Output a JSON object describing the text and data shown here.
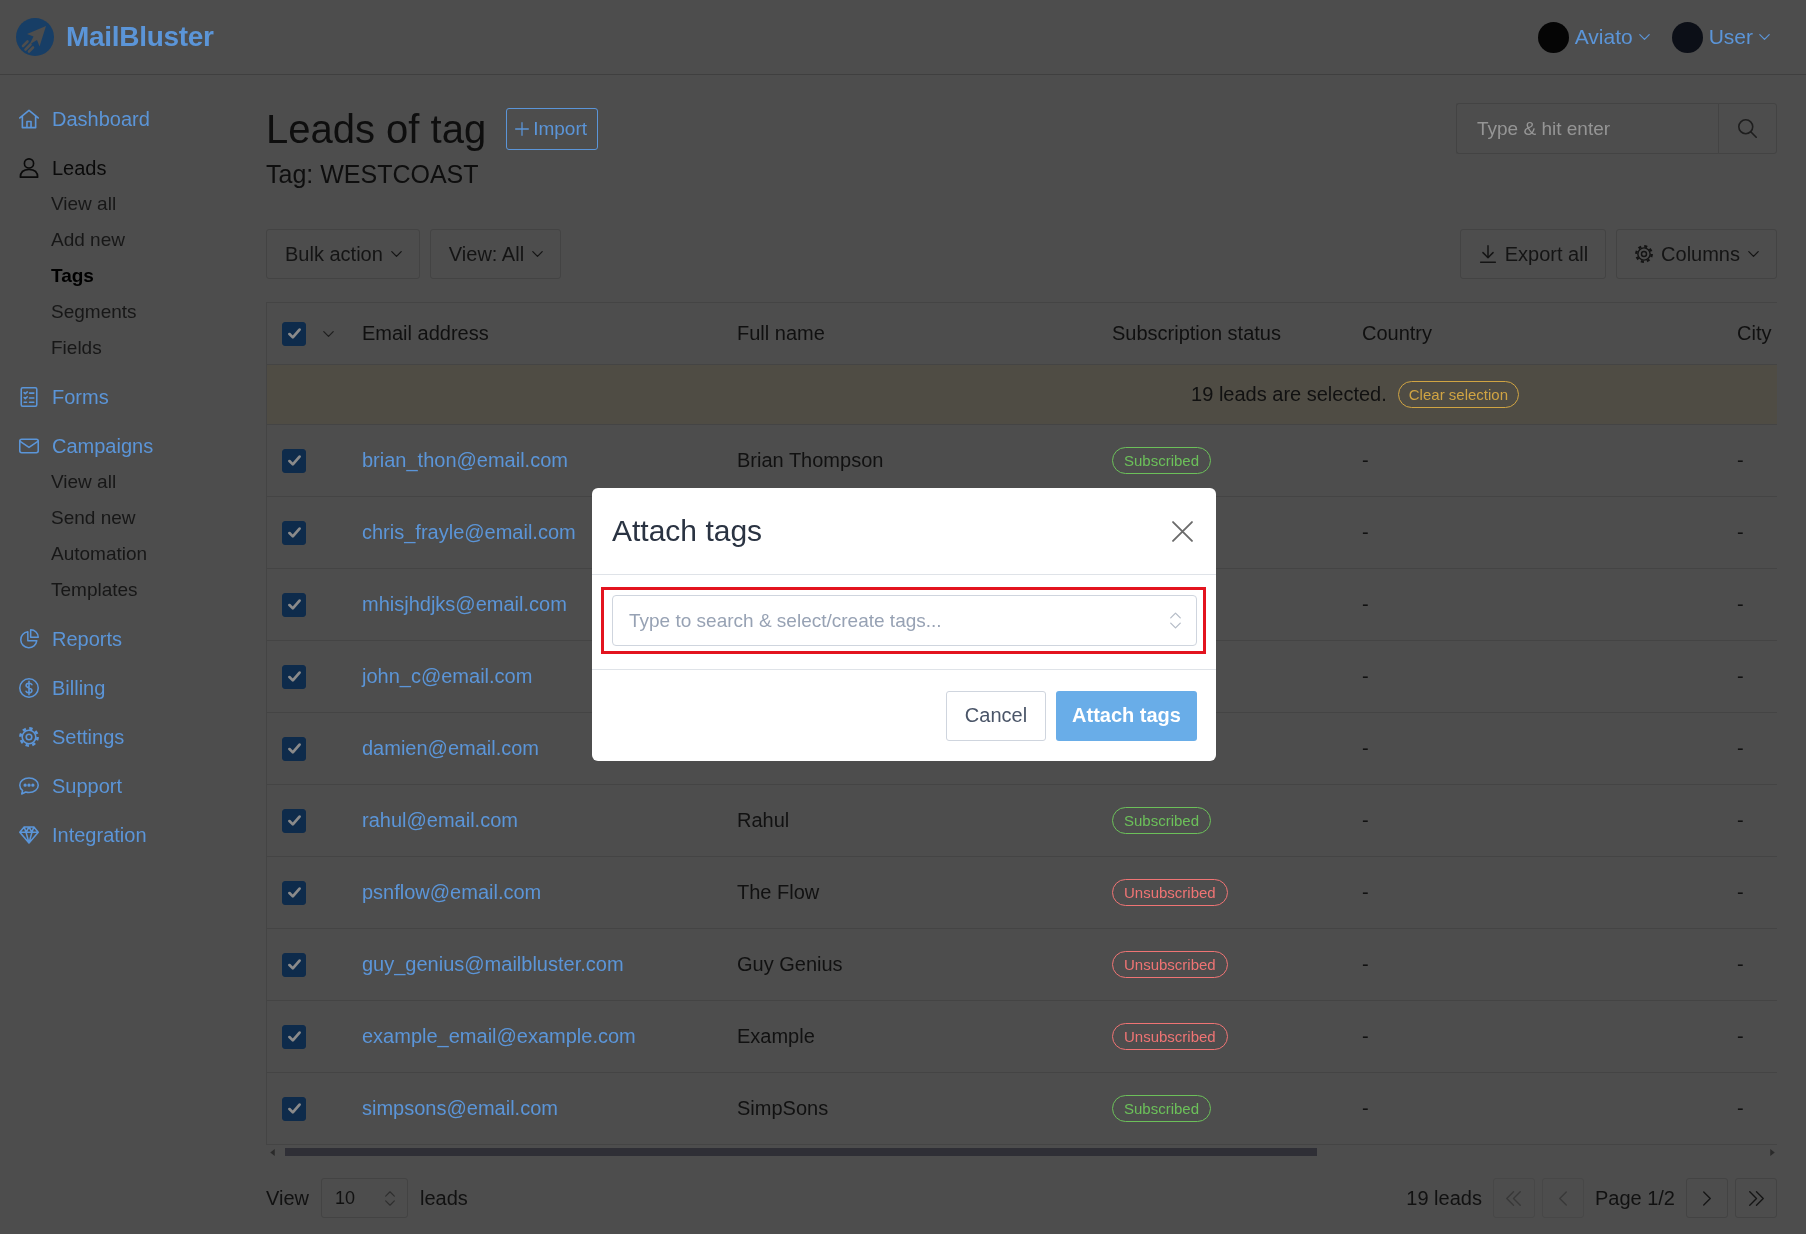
{
  "header": {
    "logo_text": "MailBluster",
    "menus": [
      {
        "label": "Aviato"
      },
      {
        "label": "User"
      }
    ]
  },
  "sidebar": {
    "items": [
      {
        "label": "Dashboard",
        "selected": false
      },
      {
        "label": "Leads",
        "selected": true,
        "children": [
          {
            "label": "View all",
            "selected": false
          },
          {
            "label": "Add new",
            "selected": false
          },
          {
            "label": "Tags",
            "selected": true
          },
          {
            "label": "Segments",
            "selected": false
          },
          {
            "label": "Fields",
            "selected": false
          }
        ]
      },
      {
        "label": "Forms",
        "selected": false
      },
      {
        "label": "Campaigns",
        "selected": false,
        "children": [
          {
            "label": "View all",
            "selected": false
          },
          {
            "label": "Send new",
            "selected": false
          },
          {
            "label": "Automation",
            "selected": false
          },
          {
            "label": "Templates",
            "selected": false
          }
        ]
      },
      {
        "label": "Reports",
        "selected": false
      },
      {
        "label": "Billing",
        "selected": false
      },
      {
        "label": "Settings",
        "selected": false
      },
      {
        "label": "Support",
        "selected": false
      },
      {
        "label": "Integration",
        "selected": false
      }
    ]
  },
  "page": {
    "title": "Leads of tag",
    "import_button": "Import",
    "subtitle": "Tag: WESTCOAST",
    "search": {
      "placeholder": "Type & hit enter"
    }
  },
  "toolbar": {
    "left": [
      {
        "label": "Bulk action",
        "kind": "dropdown"
      },
      {
        "label": "View: All",
        "kind": "dropdown"
      }
    ],
    "right": [
      {
        "label": "Export all",
        "kind": "download"
      },
      {
        "label": "Columns",
        "kind": "columns"
      }
    ]
  },
  "table": {
    "select_all_checked": true,
    "columns": [
      "Email address",
      "Full name",
      "Subscription status",
      "Country",
      "City"
    ],
    "selection_banner": {
      "text": "19 leads are selected.",
      "clear_button": "Clear selection"
    },
    "rows": [
      {
        "checked": true,
        "email": "brian_thon@email.com",
        "full_name": "Brian Thompson",
        "status": {
          "label": "Subscribed",
          "kind": "subscribed"
        },
        "country": "-",
        "city": "-"
      },
      {
        "checked": true,
        "email": "chris_frayle@email.com",
        "country": "-",
        "city": "-"
      },
      {
        "checked": true,
        "email": "mhisjhdjks@email.com",
        "country": "-",
        "city": "-"
      },
      {
        "checked": true,
        "email": "john_c@email.com",
        "country": "-",
        "city": "-"
      },
      {
        "checked": true,
        "email": "damien@email.com",
        "country": "-",
        "city": "-"
      },
      {
        "checked": true,
        "email": "rahul@email.com",
        "full_name": "Rahul",
        "status": {
          "label": "Subscribed",
          "kind": "subscribed"
        },
        "country": "-",
        "city": "-"
      },
      {
        "checked": true,
        "email": "psnflow@email.com",
        "full_name": "The Flow",
        "status": {
          "label": "Unsubscribed",
          "kind": "unsubscribed"
        },
        "country": "-",
        "city": "-"
      },
      {
        "checked": true,
        "email": "guy_genius@mailbluster.com",
        "full_name": "Guy Genius",
        "status": {
          "label": "Unsubscribed",
          "kind": "unsubscribed"
        },
        "country": "-",
        "city": "-"
      },
      {
        "checked": true,
        "email": "example_email@example.com",
        "full_name": "Example",
        "status": {
          "label": "Unsubscribed",
          "kind": "unsubscribed"
        },
        "country": "-",
        "city": "-"
      },
      {
        "checked": true,
        "email": "simpsons@email.com",
        "full_name": "SimpSons",
        "status": {
          "label": "Subscribed",
          "kind": "subscribed"
        },
        "country": "-",
        "city": "-"
      }
    ]
  },
  "footer": {
    "view_label": "View",
    "page_size": "10",
    "leads_label": "leads",
    "total": "19 leads",
    "pager_buttons": [
      {
        "kind": "first",
        "disabled": true
      },
      {
        "kind": "prev",
        "disabled": true
      },
      {
        "kind": "next",
        "disabled": false
      },
      {
        "kind": "last",
        "disabled": false
      }
    ],
    "page_label": "Page 1/2"
  },
  "modal": {
    "title": "Attach tags",
    "highlighted": true,
    "tag_input": {
      "placeholder": "Type to search & select/create tags..."
    },
    "buttons": [
      {
        "label": "Cancel",
        "kind": "secondary"
      },
      {
        "label": "Attach tags",
        "kind": "primary"
      }
    ]
  }
}
